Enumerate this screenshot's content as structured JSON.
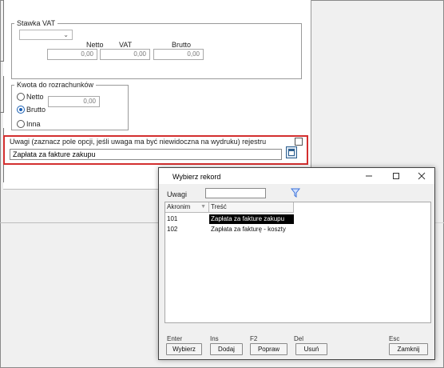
{
  "vat_group": {
    "title": "Stawka VAT",
    "select_value": "",
    "netto_label": "Netto",
    "vat_label": "VAT",
    "brutto_label": "Brutto",
    "netto_value": "0,00",
    "vat_value": "0,00",
    "brutto_value": "0,00"
  },
  "settlement_group": {
    "title": "Kwota do rozrachunków",
    "options": [
      "Netto",
      "Brutto",
      "Inna"
    ],
    "selected": "Brutto",
    "amount_value": "0,00"
  },
  "notes": {
    "label": "Uwagi  (zaznacz pole opcji, jeśli uwaga ma być niewidoczna na wydruku) rejestru",
    "value": "Zapłata za fakture zakupu",
    "hidden_on_print": false
  },
  "dialog": {
    "title": "Wybierz rekord",
    "titlebar_icons": [
      "minimize-icon",
      "maximize-icon",
      "close-icon"
    ],
    "search_label": "Uwagi",
    "search_value": "",
    "columns": [
      "Akronim",
      "Treść"
    ],
    "rows": [
      {
        "code": "101",
        "text": "Zapłata za fakture zakupu",
        "selected": true
      },
      {
        "code": "102",
        "text": "Zapłata za fakturę - koszty",
        "selected": false
      }
    ],
    "shortcuts": {
      "choose": "Enter",
      "add": "Ins",
      "edit": "F2",
      "delete": "Del",
      "close": "Esc"
    },
    "buttons": {
      "choose": "Wybierz",
      "add": "Dodaj",
      "edit": "Popraw",
      "delete": "Usuń",
      "close": "Zamknij"
    }
  },
  "colors": {
    "highlight_border": "#d32f2f",
    "selected_row_bg": "#000000",
    "radio_accent": "#1a5fb4",
    "filter_icon": "#3a6fd8"
  }
}
